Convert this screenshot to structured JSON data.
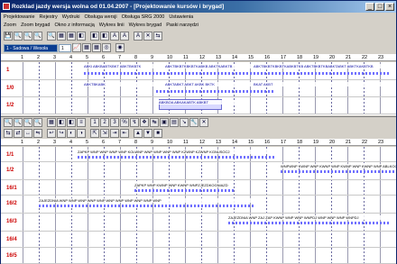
{
  "window": {
    "title": "Rozklad jazdy wersja wolna od 01.04.2007 - [Projektowanie kursów i brygad]",
    "btn_min": "_",
    "btn_max": "□",
    "btn_close": "×"
  },
  "menu1": [
    "Projektowanie",
    "Rejestry",
    "Wydruki",
    "Obsługa wersji",
    "Obsługa SRG 2000",
    "Ustawienia"
  ],
  "menu2": [
    "Zoom",
    "Zoom brygad",
    "Okno z informacją",
    "Wykres linii",
    "Wykres brygad",
    "Paski narzędzi"
  ],
  "toolbar": {
    "line_select": "1 - Sadowa / Wesoła",
    "direction_select": "1",
    "icons_a": [
      "💾",
      "🔍",
      "🔍",
      "🔍",
      "🔍",
      "▦",
      "▦",
      "◧",
      "◧",
      "◧",
      "A",
      "A",
      "A",
      "✕",
      "⇆"
    ],
    "icons_b": [
      "📈",
      "▦",
      "▦",
      "◎",
      "◉"
    ],
    "icons_c": [
      "🔍",
      "🔍",
      "🔍",
      "🔍",
      "▦",
      "◧",
      "◧",
      "≡"
    ],
    "numbers": [
      "1",
      "2",
      "3",
      "%"
    ],
    "icons_d": [
      "↯",
      "❖",
      "↹",
      "▣",
      "▤",
      "↘",
      "🔧",
      "✕"
    ],
    "icons_e": [
      "⇆",
      "⇄",
      "↔",
      "⇋",
      "↩",
      "↪",
      "◐",
      "◑",
      "⇱",
      "⇲",
      "⇥",
      "⇤",
      "▲",
      "▼",
      "■"
    ]
  },
  "ruler_top": [
    "1",
    "2",
    "3",
    "4",
    "5",
    "6",
    "7",
    "8",
    "9",
    "10",
    "11",
    "12",
    "13",
    "14",
    "15",
    "16",
    "17",
    "18",
    "19",
    "20",
    "21",
    "22",
    "23"
  ],
  "ruler_bottom": [
    "1",
    "2",
    "3",
    "4",
    "5",
    "6",
    "7",
    "8",
    "9",
    "10",
    "11",
    "12",
    "13",
    "14",
    "15",
    "16",
    "17",
    "18",
    "19",
    "20",
    "21",
    "22",
    "23"
  ],
  "top_rows": [
    {
      "label": "1",
      "text1": "ABKI ABKBABTKBKT ABKTBKBTK",
      "text2": "ABKTBKBTKBKBTKABKB ABKTKABKTB",
      "text3": "ABKTBKBTKBKBTKABKBTKB ABKTBKBTKBABKTABKT ABKTKAKBTKB"
    },
    {
      "label": "1/0",
      "text1": "ABKTBKABK",
      "text2": "ABKTABKT ABKT AKBK BKTK",
      "text3": "BKAT AKBT"
    },
    {
      "label": "1/2",
      "text1": "",
      "text2": "ABKBOA ABKAKABTK ABKBT",
      "text3": ""
    }
  ],
  "bottom_rows": [
    {
      "label": "1/1",
      "text": "ZAPKP WNP WNP WNP WNP KOLWNP WNP WNP WNP WNP KZWNP KZWNP KGNUSOC2"
    },
    {
      "label": "1/2",
      "text": "WNPWNP KWNP WNP KWNP WNP KWNP WNP KWNP WNP ABLKOGABKNABL"
    },
    {
      "label": "16/1",
      "text": "ZAPKP WNP KWNP WNP KWNP WNPZJEZDKOGNIAZD"
    },
    {
      "label": "16/2",
      "text": "ZAJEZDNIA WNP WNP WNP WNP WNP WNP WNP WNP WNP WNP WNP"
    },
    {
      "label": "16/3",
      "text": "ZAJEZDNIA WNP ZAJ ZAP KWNP WNP WNP WNPDJ WNP WNP WNP WNPDJ"
    },
    {
      "label": "16/4",
      "text": ""
    },
    {
      "label": "16/5",
      "text": ""
    }
  ]
}
